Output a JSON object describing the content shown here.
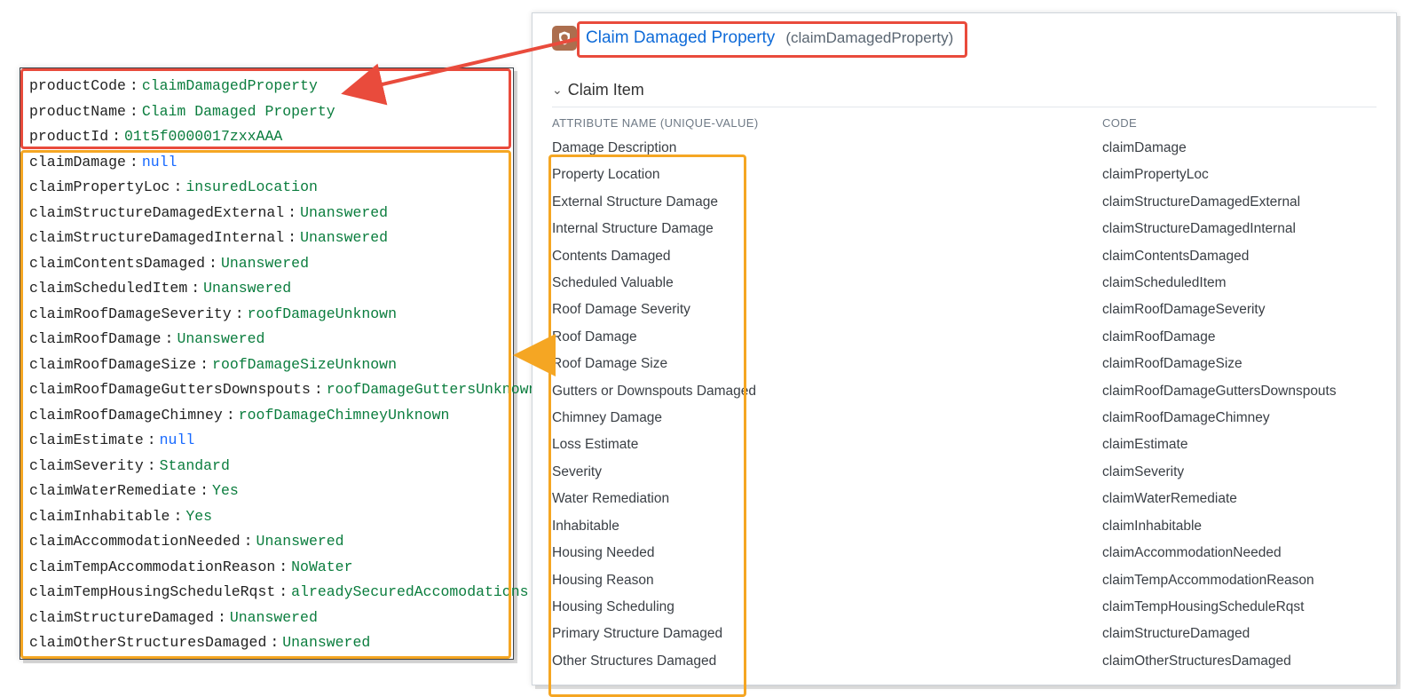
{
  "colors": {
    "highlight_red": "#e94b3c",
    "highlight_orange": "#f5a623",
    "code_green": "#0b7d3e",
    "code_blue": "#1769ff",
    "link_blue": "#0f6bd8"
  },
  "left_code": {
    "product": [
      {
        "key": "productCode",
        "value": "claimDamagedProperty",
        "type": "green"
      },
      {
        "key": "productName",
        "value": "Claim Damaged Property",
        "type": "green"
      },
      {
        "key": "productId",
        "value": "01t5f0000017zxxAAA",
        "type": "green"
      }
    ],
    "fields": [
      {
        "key": "claimDamage",
        "value": "null",
        "type": "blue"
      },
      {
        "key": "claimPropertyLoc",
        "value": "insuredLocation",
        "type": "green"
      },
      {
        "key": "claimStructureDamagedExternal",
        "value": "Unanswered",
        "type": "green"
      },
      {
        "key": "claimStructureDamagedInternal",
        "value": "Unanswered",
        "type": "green"
      },
      {
        "key": "claimContentsDamaged",
        "value": "Unanswered",
        "type": "green"
      },
      {
        "key": "claimScheduledItem",
        "value": "Unanswered",
        "type": "green"
      },
      {
        "key": "claimRoofDamageSeverity",
        "value": "roofDamageUnknown",
        "type": "green"
      },
      {
        "key": "claimRoofDamage",
        "value": "Unanswered",
        "type": "green"
      },
      {
        "key": "claimRoofDamageSize",
        "value": "roofDamageSizeUnknown",
        "type": "green"
      },
      {
        "key": "claimRoofDamageGuttersDownspouts",
        "value": "roofDamageGuttersUnknown",
        "type": "green"
      },
      {
        "key": "claimRoofDamageChimney",
        "value": "roofDamageChimneyUnknown",
        "type": "green"
      },
      {
        "key": "claimEstimate",
        "value": "null",
        "type": "blue"
      },
      {
        "key": "claimSeverity",
        "value": "Standard",
        "type": "green"
      },
      {
        "key": "claimWaterRemediate",
        "value": "Yes",
        "type": "green"
      },
      {
        "key": "claimInhabitable",
        "value": "Yes",
        "type": "green"
      },
      {
        "key": "claimAccommodationNeeded",
        "value": "Unanswered",
        "type": "green"
      },
      {
        "key": "claimTempAccommodationReason",
        "value": "NoWater",
        "type": "green"
      },
      {
        "key": "claimTempHousingScheduleRqst",
        "value": "alreadySecuredAccomodations",
        "type": "green"
      },
      {
        "key": "claimStructureDamaged",
        "value": "Unanswered",
        "type": "green"
      },
      {
        "key": "claimOtherStructuresDamaged",
        "value": "Unanswered",
        "type": "green"
      }
    ]
  },
  "right_panel": {
    "title": "Claim Damaged Property",
    "subtitle": "(claimDamagedProperty)",
    "section": "Claim Item",
    "columns": {
      "attr": "ATTRIBUTE NAME (UNIQUE-VALUE)",
      "code": "CODE"
    },
    "rows": [
      {
        "attr": "Damage Description",
        "code": "claimDamage"
      },
      {
        "attr": "Property Location",
        "code": "claimPropertyLoc"
      },
      {
        "attr": "External Structure Damage",
        "code": "claimStructureDamagedExternal"
      },
      {
        "attr": "Internal Structure Damage",
        "code": "claimStructureDamagedInternal"
      },
      {
        "attr": "Contents Damaged",
        "code": "claimContentsDamaged"
      },
      {
        "attr": "Scheduled Valuable",
        "code": "claimScheduledItem"
      },
      {
        "attr": "Roof Damage Severity",
        "code": "claimRoofDamageSeverity"
      },
      {
        "attr": "Roof Damage",
        "code": "claimRoofDamage"
      },
      {
        "attr": "Roof Damage Size",
        "code": "claimRoofDamageSize"
      },
      {
        "attr": "Gutters or Downspouts Damaged",
        "code": "claimRoofDamageGuttersDownspouts"
      },
      {
        "attr": "Chimney Damage",
        "code": "claimRoofDamageChimney"
      },
      {
        "attr": "Loss Estimate",
        "code": "claimEstimate"
      },
      {
        "attr": "Severity",
        "code": "claimSeverity"
      },
      {
        "attr": "Water Remediation",
        "code": "claimWaterRemediate"
      },
      {
        "attr": "Inhabitable",
        "code": "claimInhabitable"
      },
      {
        "attr": "Housing Needed",
        "code": "claimAccommodationNeeded"
      },
      {
        "attr": "Housing Reason",
        "code": "claimTempAccommodationReason"
      },
      {
        "attr": "Housing Scheduling",
        "code": "claimTempHousingScheduleRqst"
      },
      {
        "attr": "Primary Structure Damaged",
        "code": "claimStructureDamaged"
      },
      {
        "attr": "Other Structures Damaged",
        "code": "claimOtherStructuresDamaged"
      }
    ]
  }
}
